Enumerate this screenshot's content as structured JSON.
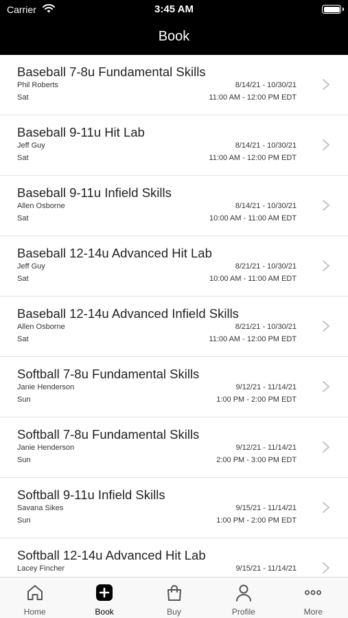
{
  "status_bar": {
    "carrier": "Carrier",
    "time": "3:45 AM"
  },
  "nav": {
    "title": "Book"
  },
  "classes": [
    {
      "name": "Baseball 7-8u Fundamental Skills",
      "coach": "Phil Roberts",
      "dates": "8/14/21 - 10/30/21",
      "day": "Sat",
      "time": "11:00 AM - 12:00 PM EDT"
    },
    {
      "name": "Baseball 9-11u Hit Lab",
      "coach": "Jeff Guy",
      "dates": "8/14/21 - 10/30/21",
      "day": "Sat",
      "time": "11:00 AM - 12:00 PM EDT"
    },
    {
      "name": "Baseball 9-11u Infield Skills",
      "coach": "Allen Osborne",
      "dates": "8/14/21 - 10/30/21",
      "day": "Sat",
      "time": "10:00 AM - 11:00 AM EDT"
    },
    {
      "name": "Baseball 12-14u Advanced Hit Lab",
      "coach": "Jeff Guy",
      "dates": "8/21/21 - 10/30/21",
      "day": "Sat",
      "time": "10:00 AM - 11:00 AM EDT"
    },
    {
      "name": "Baseball 12-14u Advanced Infield Skills",
      "coach": "Allen Osborne",
      "dates": "8/21/21 - 10/30/21",
      "day": "Sat",
      "time": "11:00 AM - 12:00 PM EDT"
    },
    {
      "name": "Softball 7-8u Fundamental Skills",
      "coach": "Janie Henderson",
      "dates": "9/12/21 - 11/14/21",
      "day": "Sun",
      "time": "1:00 PM - 2:00 PM EDT"
    },
    {
      "name": "Softball 7-8u Fundamental Skills",
      "coach": "Janie Henderson",
      "dates": "9/12/21 - 11/14/21",
      "day": "Sun",
      "time": "2:00 PM - 3:00 PM EDT"
    },
    {
      "name": "Softball 9-11u Infield Skills",
      "coach": "Savana Sikes",
      "dates": "9/15/21 - 11/14/21",
      "day": "Sun",
      "time": "1:00 PM - 2:00 PM EDT"
    },
    {
      "name": "Softball 12-14u Advanced Hit Lab",
      "coach": "Lacey Fincher",
      "dates": "9/15/21 - 11/14/21",
      "day": "",
      "time": ""
    }
  ],
  "tabs": [
    {
      "label": "Home",
      "icon": "home-icon",
      "active": false
    },
    {
      "label": "Book",
      "icon": "plus-square-icon",
      "active": true
    },
    {
      "label": "Buy",
      "icon": "shopping-bag-icon",
      "active": false
    },
    {
      "label": "Profile",
      "icon": "person-icon",
      "active": false
    },
    {
      "label": "More",
      "icon": "ellipsis-icon",
      "active": false
    }
  ],
  "colors": {
    "header_bg": "#000000",
    "active_tab": "#000000",
    "inactive_tab": "#555555",
    "chevron": "#c4c4c4"
  }
}
